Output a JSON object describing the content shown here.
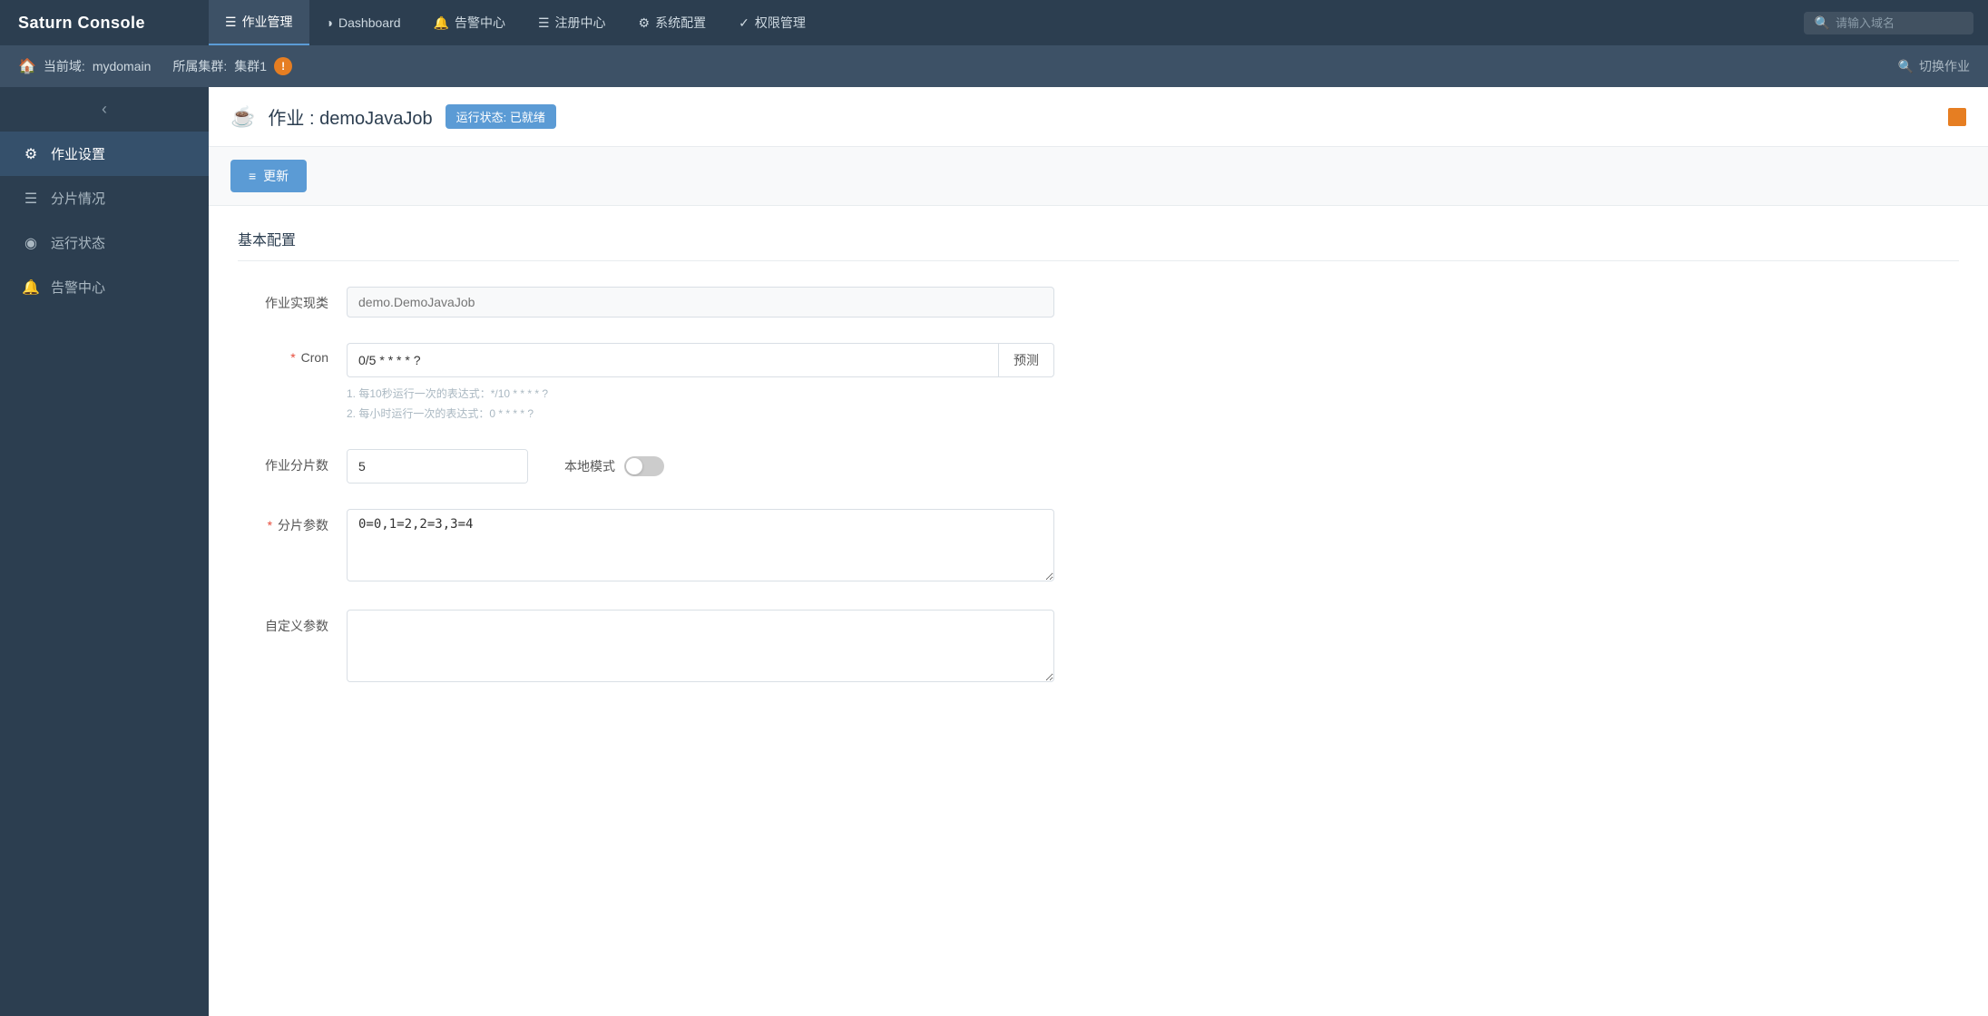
{
  "brand": {
    "title": "Saturn Console"
  },
  "topNav": {
    "tabs": [
      {
        "id": "job-management",
        "icon": "☰",
        "label": "作业管理",
        "active": true
      },
      {
        "id": "dashboard",
        "icon": "◕",
        "label": "Dashboard",
        "active": false
      },
      {
        "id": "alert-center",
        "icon": "🔔",
        "label": "告警中心",
        "active": false
      },
      {
        "id": "registration",
        "icon": "☰",
        "label": "注册中心",
        "active": false
      },
      {
        "id": "system-config",
        "icon": "⚙",
        "label": "系统配置",
        "active": false
      },
      {
        "id": "auth-management",
        "icon": "✓",
        "label": "权限管理",
        "active": false
      }
    ],
    "search": {
      "placeholder": "请输入域名",
      "icon": "🔍"
    }
  },
  "secondBar": {
    "domain_label": "当前域:",
    "domain_value": "mydomain",
    "cluster_label": "所属集群:",
    "cluster_value": "集群1",
    "switch_job_label": "切换作业",
    "switch_job_icon": "🔍"
  },
  "sidebar": {
    "collapse_icon": "‹",
    "items": [
      {
        "id": "job-settings",
        "icon": "⚙",
        "label": "作业设置",
        "active": true
      },
      {
        "id": "shard-status",
        "icon": "☰",
        "label": "分片情况",
        "active": false
      },
      {
        "id": "run-status",
        "icon": "◉",
        "label": "运行状态",
        "active": false
      },
      {
        "id": "alert-center",
        "icon": "🔔",
        "label": "告警中心",
        "active": false
      }
    ]
  },
  "pageHeader": {
    "job_icon": "☕",
    "title_prefix": "作业 : ",
    "job_name": "demoJavaJob",
    "status_badge": "运行状态: 已就绪"
  },
  "toolbar": {
    "update_btn": {
      "icon": "≡",
      "label": "更新"
    }
  },
  "basicConfig": {
    "section_title": "基本配置",
    "fields": {
      "job_class": {
        "label": "作业实现类",
        "placeholder": "demo.DemoJavaJob",
        "required": false
      },
      "cron": {
        "label": "Cron",
        "required": true,
        "value": "0/5 * * * * ?",
        "predict_btn": "预测",
        "hints": [
          "1. 每10秒运行一次的表达式：*/10 * * * * ?",
          "2. 每小时运行一次的表达式：0 * * * * ?"
        ]
      },
      "shards": {
        "label": "作业分片数",
        "required": false,
        "value": "5"
      },
      "local_mode": {
        "label": "本地模式",
        "enabled": false
      },
      "shard_params": {
        "label": "分片参数",
        "required": true,
        "value": "0=0,1=2,2=3,3=4"
      },
      "custom_params": {
        "label": "自定义参数",
        "required": false,
        "value": ""
      }
    }
  }
}
